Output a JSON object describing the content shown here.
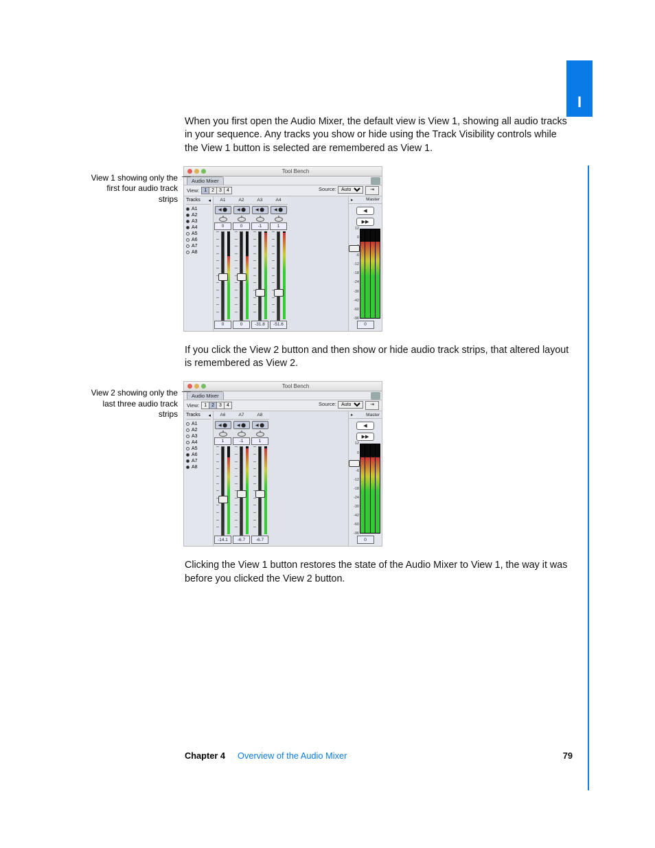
{
  "tab_label": "I",
  "body": {
    "p1": "When you first open the Audio Mixer, the default view is View 1, showing all audio tracks in your sequence. Any tracks you show or hide using the Track Visibility controls while the View 1 button is selected are remembered as View 1.",
    "p2": "If you click the View 2 button and then show or hide audio track strips, that altered layout is remembered as View 2.",
    "p3": "Clicking the View 1 button restores the state of the Audio Mixer to View 1, the way it was before you clicked the View 2 button."
  },
  "captions": {
    "c1": "View 1 showing only the first four audio track strips",
    "c2": "View 2 showing only the last three audio track strips"
  },
  "fig1": {
    "window_title": "Tool Bench",
    "tab": "Audio Mixer",
    "view_label": "View:",
    "view_buttons": [
      "1",
      "2",
      "3",
      "4"
    ],
    "active_view": 0,
    "source_label": "Source:",
    "source_value": "Auto",
    "tracks_label": "Tracks",
    "master_label": "Master",
    "track_list": [
      {
        "name": "A1",
        "on": true
      },
      {
        "name": "A2",
        "on": true
      },
      {
        "name": "A3",
        "on": true
      },
      {
        "name": "A4",
        "on": true
      },
      {
        "name": "A5",
        "on": false
      },
      {
        "name": "A6",
        "on": false
      },
      {
        "name": "A7",
        "on": false
      },
      {
        "name": "A8",
        "on": false
      }
    ],
    "strips": [
      {
        "name": "A1",
        "pan": "◀ ⬤",
        "slider": 0,
        "val": "0",
        "fader_pos": 0.48,
        "meter": 0.72,
        "readout": "0"
      },
      {
        "name": "A2",
        "pan": "◀ ⬤",
        "slider": 0,
        "val": "0",
        "fader_pos": 0.48,
        "meter": 0.72,
        "readout": "0"
      },
      {
        "name": "A3",
        "pan": "◀ ⬤",
        "slider": -1,
        "val": "-1",
        "fader_pos": 0.66,
        "meter": 0.98,
        "readout": "-31.8"
      },
      {
        "name": "A4",
        "pan": "◀ ⬤",
        "slider": 1,
        "val": "1",
        "fader_pos": 0.66,
        "meter": 0.98,
        "readout": "-51.6"
      }
    ],
    "master_buttons": [
      "◀",
      "▶▶"
    ],
    "master_scale": [
      "12",
      "0",
      "0",
      "-6",
      "-12",
      "-18",
      "-24",
      "-30",
      "-42",
      "-60",
      "-96"
    ],
    "master_knob_pos": 0.22,
    "master_bars": [
      0.86,
      0.86,
      0.86,
      0.86
    ],
    "master_readout": "0"
  },
  "fig2": {
    "window_title": "Tool Bench",
    "tab": "Audio Mixer",
    "view_label": "View:",
    "view_buttons": [
      "1",
      "2",
      "3",
      "4"
    ],
    "active_view": 1,
    "source_label": "Source:",
    "source_value": "Auto",
    "tracks_label": "Tracks",
    "master_label": "Master",
    "track_list": [
      {
        "name": "A1",
        "on": false
      },
      {
        "name": "A2",
        "on": false
      },
      {
        "name": "A3",
        "on": false
      },
      {
        "name": "A4",
        "on": false
      },
      {
        "name": "A5",
        "on": false
      },
      {
        "name": "A6",
        "on": true
      },
      {
        "name": "A7",
        "on": true
      },
      {
        "name": "A8",
        "on": true
      }
    ],
    "strips": [
      {
        "name": "A6",
        "pan": "◀ ⬤",
        "slider": 0,
        "val": "1",
        "fader_pos": 0.56,
        "meter": 0.88,
        "readout": "-14.1"
      },
      {
        "name": "A7",
        "pan": "◀ ⬤",
        "slider": -1,
        "val": "-1",
        "fader_pos": 0.5,
        "meter": 0.98,
        "readout": "-6.7"
      },
      {
        "name": "A8",
        "pan": "◀ ⬤",
        "slider": 1,
        "val": "1",
        "fader_pos": 0.5,
        "meter": 0.98,
        "readout": "-6.7"
      }
    ],
    "master_buttons": [
      "◀",
      "▶▶"
    ],
    "master_scale": [
      "12",
      "0",
      "0",
      "-6",
      "-12",
      "-18",
      "-24",
      "-30",
      "-42",
      "-60",
      "-96"
    ],
    "master_knob_pos": 0.22,
    "master_bars": [
      0.86,
      0.86,
      0.86,
      0.86
    ],
    "master_readout": "0"
  },
  "footer": {
    "chapter": "Chapter 4",
    "title": "Overview of the Audio Mixer",
    "page": "79"
  }
}
